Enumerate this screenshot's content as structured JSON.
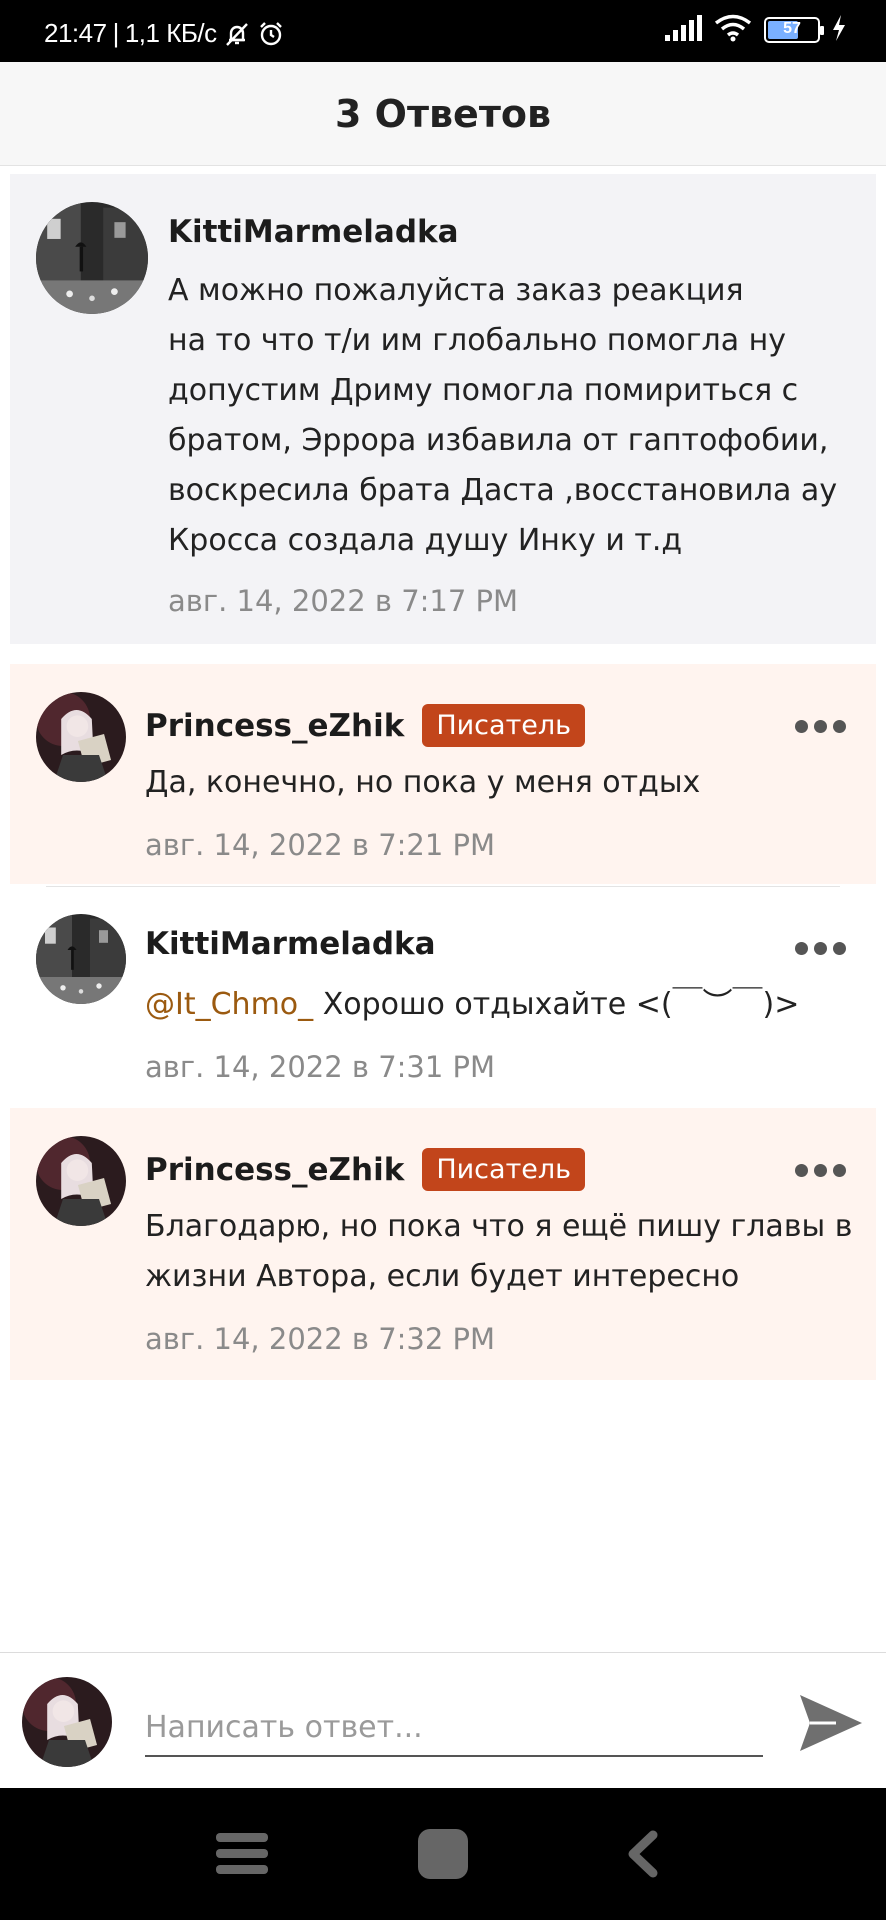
{
  "status_bar": {
    "time": "21:47",
    "speed": "1,1 КБ/с",
    "battery": "57"
  },
  "header": {
    "title": "3 Ответов"
  },
  "comments": [
    {
      "username": "KittiMarmeladka",
      "badge": "",
      "lines": [
        "А можно пожалуйста заказ реакция",
        "на то что т/и им глобально помогла ну",
        "допустим Дриму помогла помириться с",
        "братом, Эррора избавила от гаптофобии,",
        "воскресила брата Даста ,восстановила ау",
        "Кросса создала душу Инку и т.д"
      ],
      "time": "авг. 14, 2022 в 7:17 PM"
    },
    {
      "username": "Princess_eZhik",
      "badge": "Писатель",
      "lines": [
        "Да, конечно, но пока у меня отдых"
      ],
      "time": "авг. 14, 2022 в 7:21 PM"
    },
    {
      "username": "KittiMarmeladka",
      "badge": "",
      "mention": "@It_Chmo_",
      "lines": [
        " Хорошо отдыхайте <(￣︶￣)>"
      ],
      "time": "авг. 14, 2022 в 7:31 PM"
    },
    {
      "username": "Princess_eZhik",
      "badge": "Писатель",
      "lines": [
        "Благодарю, но пока что я ещё пишу главы в",
        "жизни Автора, если будет интересно"
      ],
      "time": "авг. 14, 2022 в 7:32 PM"
    }
  ],
  "reply": {
    "placeholder": "Написать ответ..."
  },
  "colors": {
    "badge": "#c2451b",
    "mention": "#9b5a10",
    "highlight_bg": "#fff4ef",
    "parent_bg": "#f3f3f6"
  },
  "icons": [
    "mute-icon",
    "alarm-icon",
    "signal-icon",
    "wifi-icon",
    "battery-icon",
    "charging-icon",
    "more-icon",
    "send-icon",
    "menu-icon",
    "home-icon",
    "back-icon"
  ]
}
